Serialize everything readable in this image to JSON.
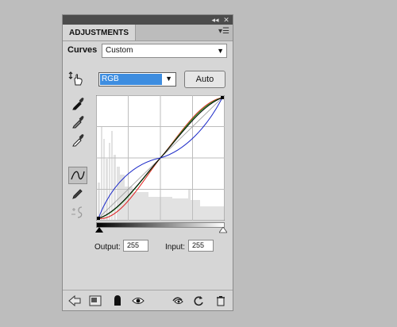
{
  "panel": {
    "tab_label": "ADJUSTMENTS",
    "title_buttons": [
      "◂◂",
      "✕"
    ]
  },
  "curves": {
    "label": "Curves",
    "preset_value": "Custom"
  },
  "channel": {
    "value": "RGB"
  },
  "auto_button": {
    "label": "Auto"
  },
  "io": {
    "output_label": "Output:",
    "output_value": "255",
    "input_label": "Input:",
    "input_value": "255"
  },
  "colors": {
    "selection_blue": "#3d8de0",
    "curve_rgb": "#000000",
    "curve_red": "#e02020",
    "curve_green": "#20a020",
    "curve_blue": "#1a28c8",
    "panel_bg": "#d6d6d6"
  },
  "icons": {
    "left_tools": [
      "on-image-adjust-icon",
      "black-point-eyedropper-icon",
      "gray-point-eyedropper-icon",
      "white-point-eyedropper-icon",
      "curve-points-icon",
      "pencil-draw-icon",
      "smooth-curve-icon"
    ],
    "bottom_tools": [
      "back-arrow-icon",
      "expand-view-icon",
      "clip-layer-icon",
      "visibility-eye-icon",
      "previous-state-icon",
      "reset-icon",
      "trash-icon"
    ]
  }
}
